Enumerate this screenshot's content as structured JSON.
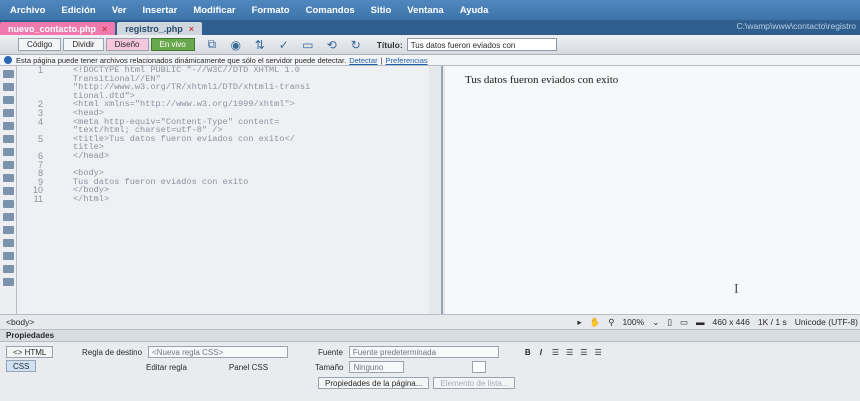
{
  "menu": [
    "Archivo",
    "Edición",
    "Ver",
    "Insertar",
    "Modificar",
    "Formato",
    "Comandos",
    "Sitio",
    "Ventana",
    "Ayuda"
  ],
  "tabs": [
    {
      "label": "nuevo_contacto.php",
      "close": "×"
    },
    {
      "label": "registro_.php",
      "close": "×"
    }
  ],
  "path": "C:\\wamp\\www\\contacto\\registro",
  "toolbar": {
    "view_buttons": [
      "Código",
      "Dividir",
      "Diseño",
      "En vivo"
    ],
    "title_label": "Título:",
    "title_value": "Tus datos fueron eviados con"
  },
  "info": {
    "text": "Esta página puede tener archivos relacionados dinámicamente que sólo el servidor puede detectar.",
    "detect": "Detectar",
    "sep": "|",
    "prefs": "Preferencias"
  },
  "code": {
    "line_numbers": [
      "1",
      "",
      "",
      "",
      "2",
      "3",
      "4",
      "",
      "5",
      "",
      "6",
      "7",
      "8",
      "9",
      "10",
      "11"
    ],
    "lines": [
      "<!DOCTYPE html PUBLIC \"-//W3C//DTD XHTML 1.0",
      "Transitional//EN\"",
      "\"http://www.w3.org/TR/xhtml1/DTD/xhtml1-transi",
      "tional.dtd\">",
      "<html xmlns=\"http://www.w3.org/1999/xhtml\">",
      "<head>",
      "<meta http-equiv=\"Content-Type\" content=",
      "\"text/html; charset=utf-8\" />",
      "<title>Tus datos fueron eviados con exito</",
      "title>",
      "</head>",
      "",
      "<body>",
      "Tus datos fueron eviados con exito",
      "</body>",
      "</html>"
    ]
  },
  "design": {
    "text": "Tus datos fueron eviados con exito",
    "cursor": "I"
  },
  "status": {
    "tag": "<body>",
    "zoom": "100%",
    "size": "460 x 446",
    "weight": "1K / 1 s",
    "encoding": "Unicode (UTF-8)"
  },
  "props": {
    "title": "Propiedades",
    "html_btn": "<> HTML",
    "css_btn": "CSS",
    "regla_label": "Regla de destino",
    "regla_value": "<Nueva regla CSS>",
    "editar": "Editar regla",
    "panel": "Panel CSS",
    "fuente_label": "Fuente",
    "fuente_value": "Fuente predeterminada",
    "tamano_label": "Tamaño",
    "tamano_value": "Ninguno",
    "bold": "B",
    "italic": "I",
    "page_props": "Propiedades de la página...",
    "list_item": "Elemento de lista..."
  }
}
